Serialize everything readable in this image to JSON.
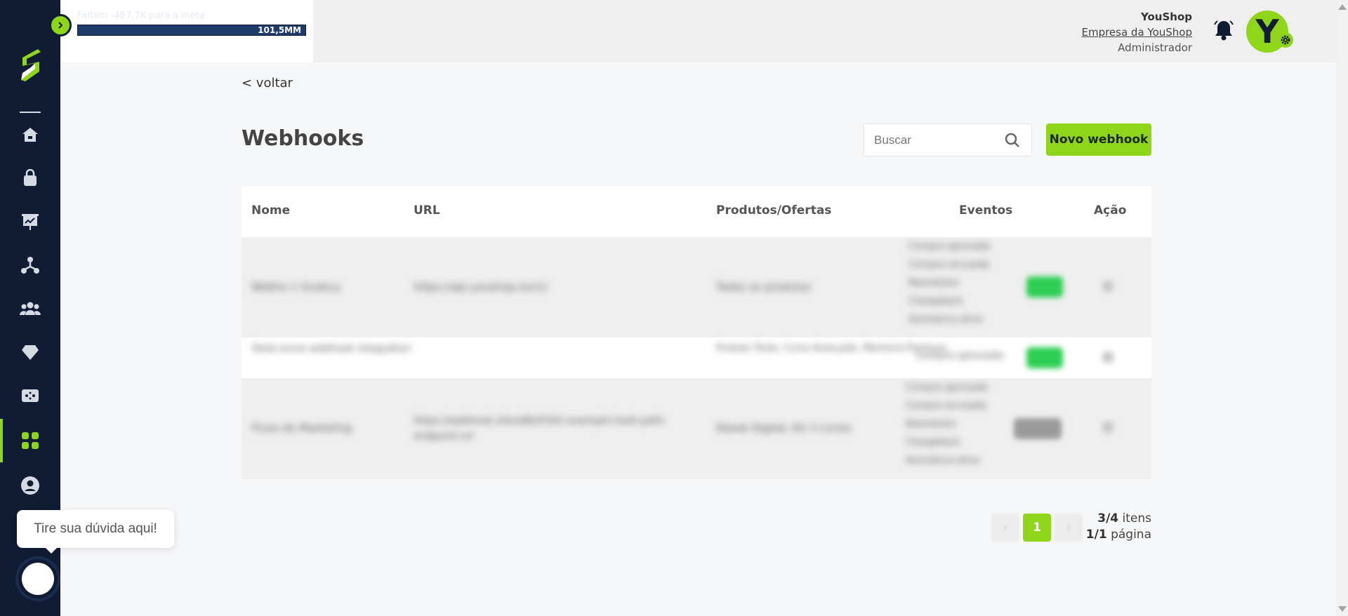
{
  "goal": {
    "text": "Faltam -487,7K para a meta",
    "bar_label": "101,5MM",
    "progress": 1.0
  },
  "header": {
    "user_name": "YouShop",
    "company": "Empresa da YouShop",
    "role": "Administrador",
    "avatar_letter": "Y"
  },
  "sidebar": {
    "items": [
      {
        "icon": "home-icon"
      },
      {
        "icon": "shopping-bag-icon"
      },
      {
        "icon": "presentation-chart-icon"
      },
      {
        "icon": "network-icon"
      },
      {
        "icon": "users-icon"
      },
      {
        "icon": "diamond-icon"
      },
      {
        "icon": "ticket-icon"
      },
      {
        "icon": "apps-grid-icon",
        "active": true
      },
      {
        "icon": "user-circle-icon"
      }
    ]
  },
  "main": {
    "back_label": "< voltar",
    "title": "Webhooks",
    "search_placeholder": "Buscar",
    "new_button": "Novo webhook",
    "table": {
      "headers": [
        "Nome",
        "URL",
        "Produtos/Ofertas",
        "Eventos",
        "Ação"
      ],
      "rows": [
        {
          "name": "Webho 1 Scalecy",
          "url": "https://api.youshop.io/v1/",
          "products": "Todos os produtos",
          "events": [
            "Compra aprovada",
            "Compra recusada",
            "Reembolso",
            "Chargeback",
            "Assinatura ativa"
          ],
          "status": "Ativo"
        },
        {
          "name": "Teste envio webhook integration",
          "url": "",
          "products": "Produto Teste, Curso Avançado, Mentoria Premium",
          "events": [
            "Compra aprovada"
          ],
          "status": "Ativo"
        },
        {
          "name": "Fluxo de Marketing",
          "url": "https://webhook.site/a8b2f3d1-example-hook-path-endpoint-url",
          "products": "Ebook Digital, Kit 3 Livros",
          "events": [
            "Compra aprovada",
            "Compra recusada",
            "Reembolso",
            "Chargeback",
            "Assinatura ativa"
          ],
          "status": "Inativo"
        }
      ]
    },
    "pagination": {
      "prev": "‹",
      "current": "1",
      "next": "›",
      "items_count": "3/4",
      "items_label": "itens",
      "page_count": "1/1",
      "page_label": "página"
    }
  },
  "help": {
    "bubble_text": "Tire sua dúvida aqui!"
  },
  "colors": {
    "accent": "#8fd61b",
    "sidebar": "#0f1c33",
    "active_chip": "#2ccd52"
  }
}
